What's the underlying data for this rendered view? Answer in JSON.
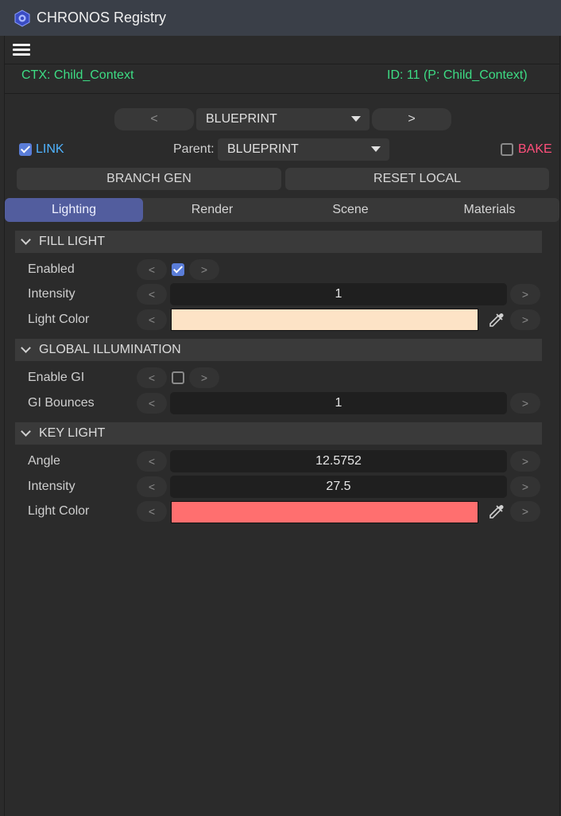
{
  "window": {
    "title": "CHRONOS Registry"
  },
  "context": {
    "ctx_label": "CTX: Child_Context",
    "id_label": "ID: 11 (P: Child_Context)"
  },
  "nav": {
    "prev": "<",
    "next": ">",
    "blueprint": "BLUEPRINT"
  },
  "link": {
    "label": "LINK",
    "checked": true,
    "color": "#4fb3ff"
  },
  "parent": {
    "label": "Parent:",
    "value": "BLUEPRINT"
  },
  "bake": {
    "label": "BAKE",
    "checked": false,
    "color": "#ff4f7b"
  },
  "actions": {
    "branch_gen": "BRANCH GEN",
    "reset_local": "RESET LOCAL"
  },
  "tabs": [
    {
      "label": "Lighting",
      "active": true
    },
    {
      "label": "Render",
      "active": false
    },
    {
      "label": "Scene",
      "active": false
    },
    {
      "label": "Materials",
      "active": false
    }
  ],
  "sections": {
    "fill_light": {
      "title": "FILL LIGHT",
      "enabled_label": "Enabled",
      "enabled": true,
      "intensity_label": "Intensity",
      "intensity": "1",
      "color_label": "Light Color",
      "color": "#fde3c6"
    },
    "gi": {
      "title": "GLOBAL ILLUMINATION",
      "enable_label": "Enable GI",
      "enable": false,
      "bounces_label": "GI Bounces",
      "bounces": "1"
    },
    "key_light": {
      "title": "KEY LIGHT",
      "angle_label": "Angle",
      "angle": "12.5752",
      "intensity_label": "Intensity",
      "intensity": "27.5",
      "color_label": "Light Color",
      "color": "#ff6f6f"
    }
  },
  "arrows": {
    "left": "<",
    "right": ">"
  },
  "icons": {
    "app": "chronos-logo-icon",
    "menu": "hamburger-menu-icon",
    "picker": "eyedropper-icon"
  },
  "colors": {
    "accent": "#525d9e",
    "ctx_text": "#3ddc84",
    "checkbox": "#5a7dd8"
  }
}
